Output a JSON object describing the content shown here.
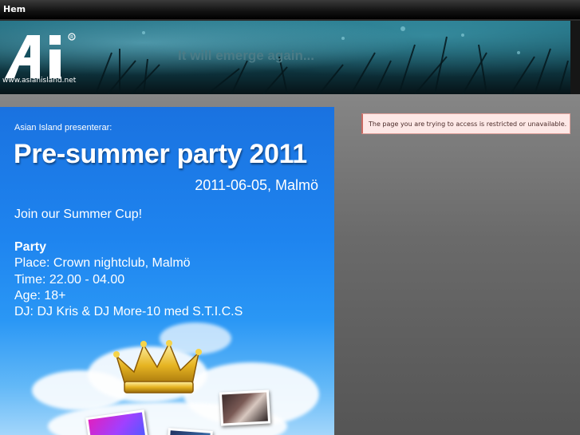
{
  "nav": {
    "home_label": "Hem"
  },
  "header": {
    "logo_text": "Ai",
    "logo_url": "www.asianisland.net",
    "tagline": "It will emerge again..."
  },
  "poster": {
    "presents": "Asian Island presenterar:",
    "title": "Pre-summer party 2011",
    "date_location": "2011-06-05, Malmö",
    "cup": "Join our Summer Cup!",
    "section": "Party",
    "place": "Place: Crown nightclub, Malmö",
    "time": "Time: 22.00 - 04.00",
    "age": "Age: 18+",
    "dj": "DJ: DJ Kris & DJ More-10 med S.T.I.C.S"
  },
  "notice": {
    "message": "The page you are trying to access is restricted or unavailable."
  },
  "colors": {
    "poster_blue": "#1e84ef",
    "notice_bg": "#fde8e6",
    "notice_border": "#e0a09a"
  }
}
